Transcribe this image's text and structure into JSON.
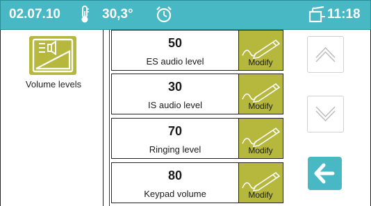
{
  "status_bar": {
    "date": "02.07.10",
    "temperature": "30,3°",
    "time": "11:18",
    "icons": [
      "thermometer-icon",
      "alarm-clock-icon",
      "handset-icon"
    ]
  },
  "feature": {
    "icon": "speaker-volume-icon",
    "label": "Volume levels"
  },
  "levels": [
    {
      "value": "50",
      "label": "ES audio level",
      "action": "Modify"
    },
    {
      "value": "30",
      "label": "IS audio level",
      "action": "Modify"
    },
    {
      "value": "70",
      "label": "Ringing level",
      "action": "Modify"
    },
    {
      "value": "80",
      "label": "Keypad volume",
      "action": "Modify"
    }
  ],
  "nav": {
    "scroll_up_icon": "chevron-up-icon",
    "scroll_down_icon": "chevron-down-icon",
    "back_icon": "back-arrow-icon"
  },
  "colors": {
    "status_bar": "#48b8c5",
    "accent_olive": "#b5b83c",
    "back_button": "#48b8c5"
  }
}
